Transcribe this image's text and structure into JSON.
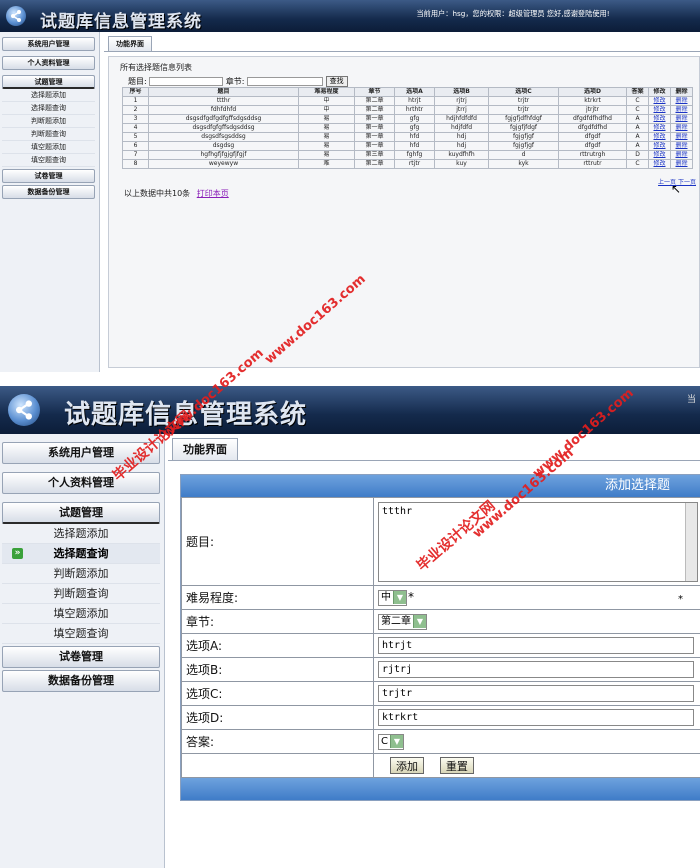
{
  "app": {
    "title": "试题库信息管理系统",
    "user_info": "当前用户：hsg，您的权限：超级管理员 您好,感谢登陆使用!",
    "edge_glyph": "当"
  },
  "sidebar": {
    "sections": [
      {
        "label": "系统用户管理"
      },
      {
        "label": "个人资料管理"
      },
      {
        "label": "试题管理"
      },
      {
        "label": "试卷管理"
      },
      {
        "label": "数据备份管理"
      }
    ],
    "items": [
      {
        "label": "选择题添加"
      },
      {
        "label": "选择题查询"
      },
      {
        "label": "判断题添加"
      },
      {
        "label": "判断题查询"
      },
      {
        "label": "填空题添加"
      },
      {
        "label": "填空题查询"
      }
    ],
    "active_arrow": "»"
  },
  "tab": {
    "label": "功能界面"
  },
  "list": {
    "title": "所有选择题信息列表",
    "search": {
      "title_label": "题目:",
      "chapter_label": "章节:",
      "button": "查找"
    },
    "columns": [
      "序号",
      "题目",
      "难易程度",
      "章节",
      "选项A",
      "选项B",
      "选项C",
      "选项D",
      "答案",
      "修改",
      "删除"
    ],
    "rows": [
      [
        "1",
        "ttthr",
        "中",
        "第二章",
        "htrjt",
        "rjtrj",
        "trjtr",
        "ktrkrt",
        "C",
        "修改",
        "删除"
      ],
      [
        "2",
        "fdhfdhfd",
        "中",
        "第二章",
        "hrthtr",
        "jtrrj",
        "trjtr",
        "jtrjtr",
        "C",
        "修改",
        "删除"
      ],
      [
        "3",
        "dsgsdfgdfgdfgffsdgsddsg",
        "易",
        "第一章",
        "gfg",
        "hdjhfdfdfd",
        "fgjgfjdfhfdgf",
        "dfgdfdfhdfhd",
        "A",
        "修改",
        "删除"
      ],
      [
        "4",
        "dsgsdfgfgffsdgsddsg",
        "易",
        "第一章",
        "gfg",
        "hdjfdfd",
        "fgjgfjfdgf",
        "dfgdfdfhd",
        "A",
        "修改",
        "删除"
      ],
      [
        "5",
        "dsgsdfsgsddsg",
        "易",
        "第一章",
        "hfd",
        "hdj",
        "fgjgfjgf",
        "dfgdf",
        "A",
        "修改",
        "删除"
      ],
      [
        "6",
        "dsgdsg",
        "易",
        "第一章",
        "hfd",
        "hdj",
        "fgjgfjgf",
        "dfgdf",
        "A",
        "修改",
        "删除"
      ],
      [
        "7",
        "hgfhgfjfgjgfjfgjf",
        "易",
        "第三章",
        "fghfg",
        "kuydfhfh",
        "d",
        "rttrutrgh",
        "D",
        "修改",
        "删除"
      ],
      [
        "8",
        "weyewyw",
        "难",
        "第二章",
        "rtjtr",
        "kuy",
        "kyk",
        "rttrutr",
        "C",
        "修改",
        "删除"
      ]
    ],
    "pager": {
      "prev": "上一页",
      "next": "下一页"
    },
    "summary": "以上数据中共10条",
    "print_link": "打印本页"
  },
  "form": {
    "header": "添加选择题",
    "fields": {
      "title": {
        "label": "题目:",
        "value": "ttthr"
      },
      "difficulty": {
        "label": "难易程度:",
        "value": "中",
        "required_mark": "*"
      },
      "chapter": {
        "label": "章节:",
        "value": "第二章"
      },
      "option_a": {
        "label": "选项A:",
        "value": "htrjt"
      },
      "option_b": {
        "label": "选项B:",
        "value": "rjtrj"
      },
      "option_c": {
        "label": "选项C:",
        "value": "trjtr"
      },
      "option_d": {
        "label": "选项D:",
        "value": "ktrkrt"
      },
      "answer": {
        "label": "答案:",
        "value": "C"
      }
    },
    "buttons": {
      "submit": "添加",
      "reset": "重置"
    },
    "right_mark": "*"
  },
  "watermarks": {
    "url": "www.doc163.com",
    "cn": "毕业设计论文网"
  },
  "colors": {
    "header_bg": "#142a4c",
    "form_bar": "#4a86cf",
    "link": "#1a33c4",
    "watermark": "#e21e1e"
  }
}
